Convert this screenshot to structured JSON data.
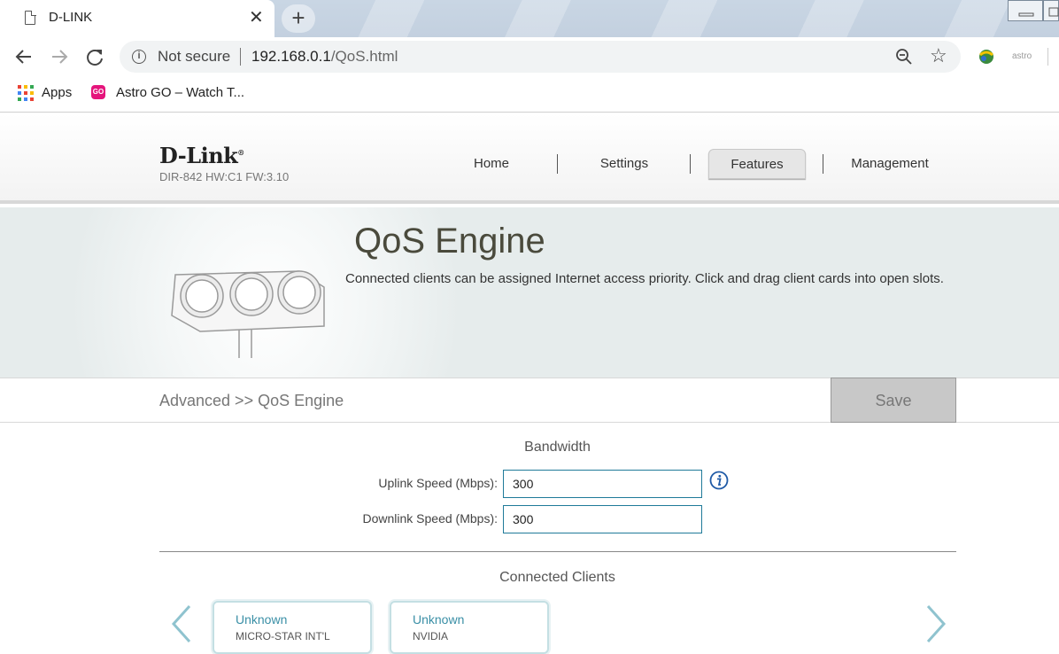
{
  "browser": {
    "tab_title": "D-LINK",
    "tab_close": "✕",
    "new_tab": "+",
    "security_label": "Not secure",
    "url_host": "192.168.0.1",
    "url_path": "/QoS.html",
    "extension_label": "astro"
  },
  "bookmarks": [
    {
      "label": "Apps",
      "icon": "apps-grid-icon"
    },
    {
      "label": "Astro GO – Watch T...",
      "icon": "astro-go-icon",
      "icon_text": "GO"
    }
  ],
  "header": {
    "logo": "D-Link",
    "device_info": "DIR-842 HW:C1 FW:3.10",
    "nav": [
      {
        "label": "Home",
        "active": false
      },
      {
        "label": "Settings",
        "active": false
      },
      {
        "label": "Features",
        "active": true
      },
      {
        "label": "Management",
        "active": false
      }
    ]
  },
  "banner": {
    "title": "QoS Engine",
    "description": "Connected clients can be assigned Internet access priority. Click and drag client cards into open slots."
  },
  "breadcrumb": "Advanced >> QoS Engine",
  "save_label": "Save",
  "bandwidth": {
    "title": "Bandwidth",
    "uplink_label": "Uplink Speed (Mbps):",
    "uplink_value": "300",
    "downlink_label": "Downlink Speed (Mbps):",
    "downlink_value": "300"
  },
  "clients": {
    "title": "Connected Clients",
    "cards": [
      {
        "type": "Unknown",
        "vendor": "MICRO-STAR INT'L"
      },
      {
        "type": "Unknown",
        "vendor": "NVIDIA"
      }
    ]
  },
  "colors": {
    "accent": "#1f7a99",
    "card_title": "#3a8fa6"
  }
}
